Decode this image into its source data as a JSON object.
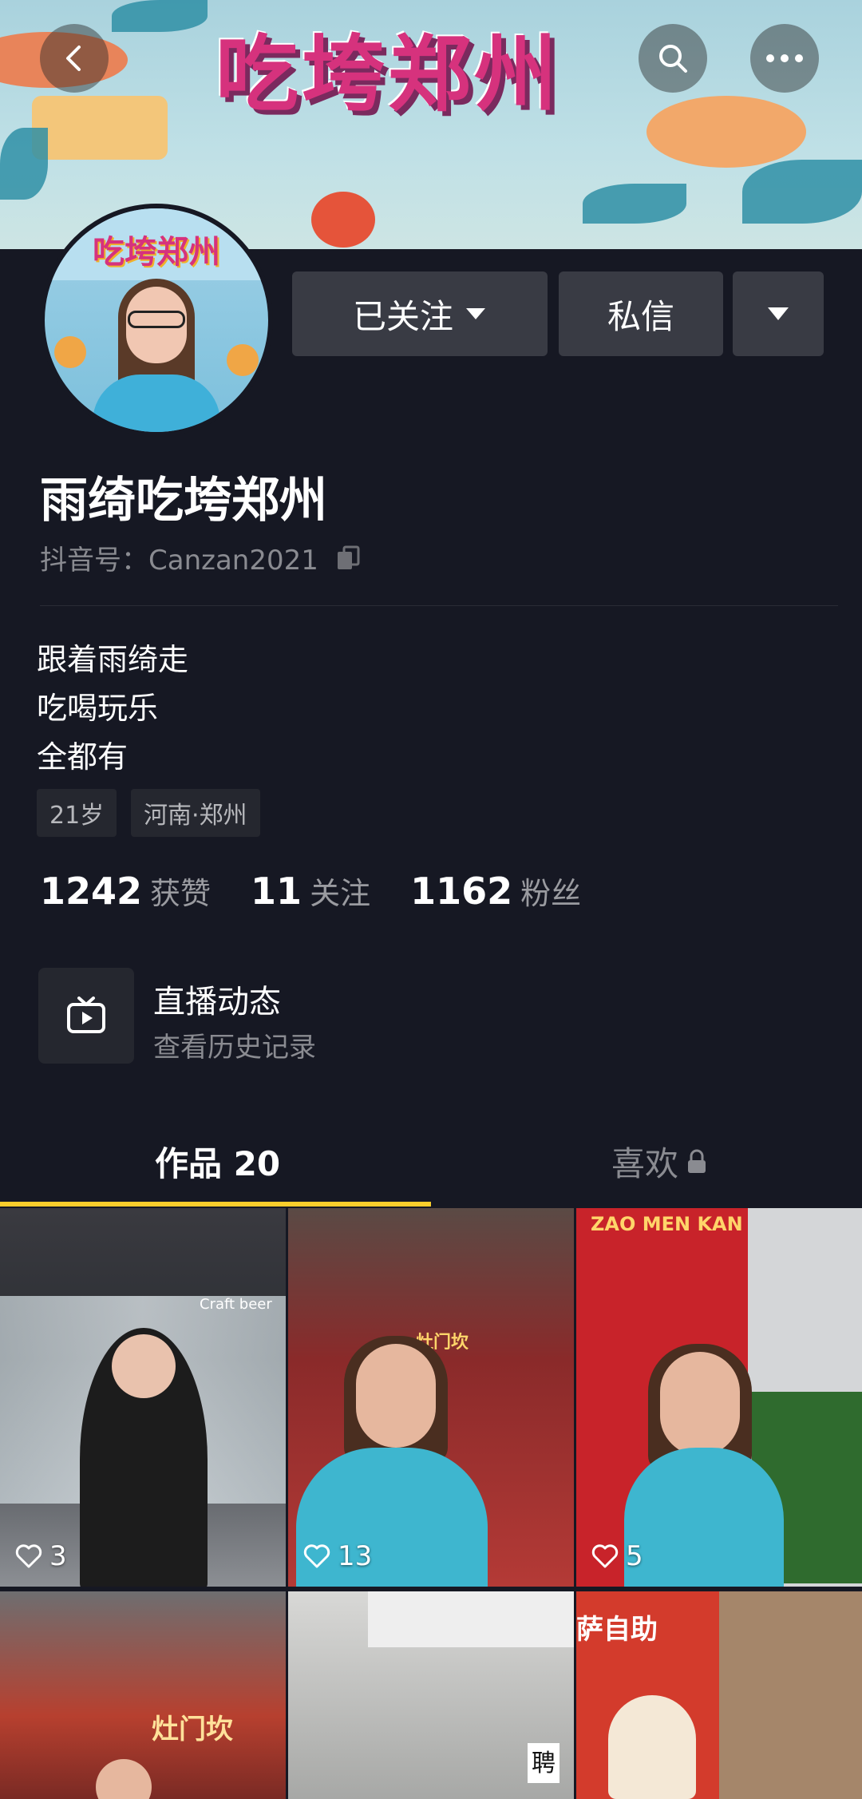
{
  "header": {
    "banner_title": "吃垮郑州",
    "avatar_title": "吃垮郑州",
    "back_icon": "back-arrow-icon",
    "search_icon": "search-icon",
    "more_icon": "more-icon"
  },
  "actions": {
    "follow_label": "已关注",
    "message_label": "私信"
  },
  "profile": {
    "name": "雨绮吃垮郑州",
    "douyin_id": "抖音号：Canzan2021",
    "bio": [
      "跟着雨绮走",
      "吃喝玩乐",
      "全都有"
    ],
    "tags": [
      "21岁",
      "河南·郑州"
    ]
  },
  "stats": [
    {
      "num": "1242",
      "label": "获赞"
    },
    {
      "num": "11",
      "label": "关注"
    },
    {
      "num": "1162",
      "label": "粉丝"
    }
  ],
  "live": {
    "title": "直播动态",
    "subtitle": "查看历史记录"
  },
  "tabs": {
    "works": "作品 20",
    "likes": "喜欢"
  },
  "videos": [
    {
      "likes": "3",
      "sign": "Craft beer"
    },
    {
      "likes": "13",
      "sign": "灶门坎"
    },
    {
      "likes": "5",
      "sign": "ZAO MEN KAN"
    },
    {
      "likes": "",
      "sign": "灶门坎"
    },
    {
      "likes": "",
      "sign": "聘"
    },
    {
      "likes": "",
      "sign": "萨自助"
    }
  ],
  "colors": {
    "background": "#161823",
    "button": "#393b44",
    "tab_indicator": "#fbce2c"
  }
}
